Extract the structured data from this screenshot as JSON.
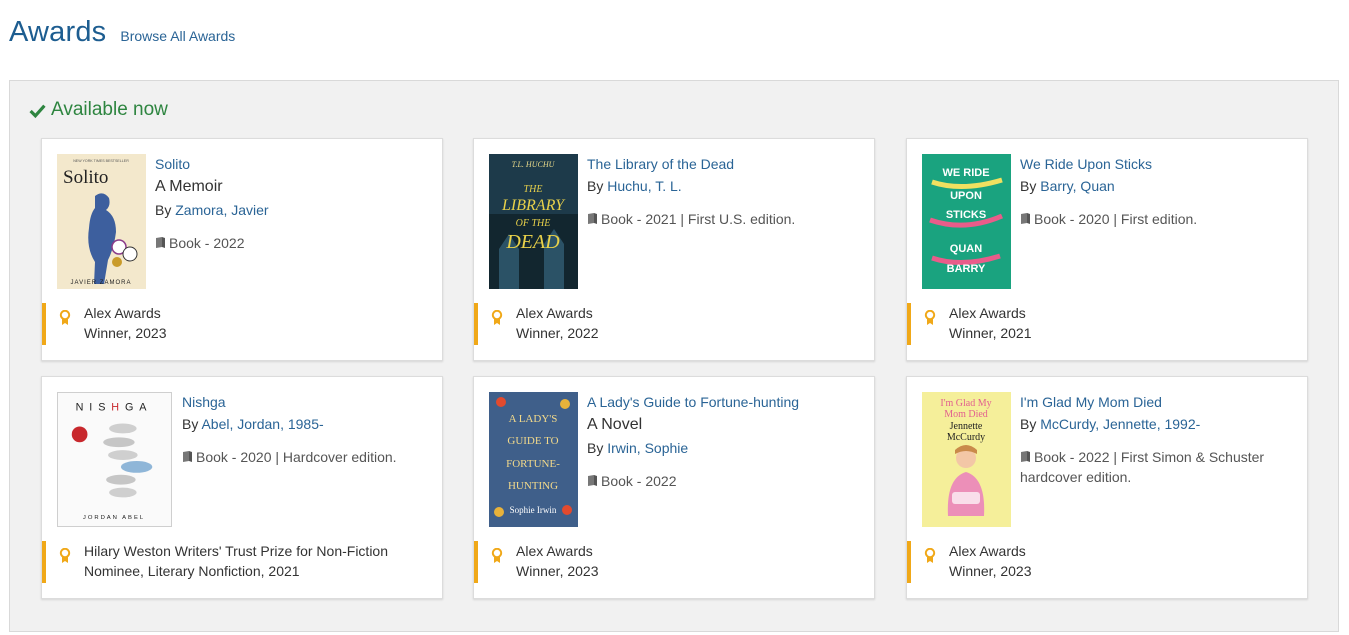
{
  "header": {
    "title": "Awards",
    "browse_link": "Browse All Awards"
  },
  "section": {
    "available_label": "Available now"
  },
  "colors": {
    "brand_blue": "#1d5d90",
    "link": "#2a6496",
    "available_green": "#2e8540",
    "award_accent": "#f0a818"
  },
  "cards": [
    {
      "title": "Solito",
      "subtitle": "A Memoir",
      "by_prefix": "By",
      "author": "Zamora, Javier",
      "format": "Book - 2022",
      "award_name": "Alex Awards",
      "award_detail": "Winner, 2023",
      "cover": {
        "top_text": "NEW YORK TIMES BESTSELLER",
        "title": "Solito",
        "author": "JAVIER ZAMORA"
      }
    },
    {
      "title": "The Library of the Dead",
      "by_prefix": "By",
      "author": "Huchu, T. L.",
      "format": "Book - 2021 | First U.S. edition.",
      "award_name": "Alex Awards",
      "award_detail": "Winner, 2022",
      "cover": {
        "author": "T.L. HUCHU",
        "line1": "THE",
        "line2": "LIBRARY",
        "line3": "OF THE",
        "line4": "DEAD"
      }
    },
    {
      "title": "We Ride Upon Sticks",
      "by_prefix": "By",
      "author": "Barry, Quan",
      "format": "Book - 2020 | First edition.",
      "award_name": "Alex Awards",
      "award_detail": "Winner, 2021",
      "cover": {
        "line1": "WE RIDE",
        "line2": "UPON",
        "line3": "STICKS",
        "line4": "QUAN",
        "line5": "BARRY"
      }
    },
    {
      "title": "Nishga",
      "by_prefix": "By",
      "author": "Abel, Jordan, 1985-",
      "format": "Book - 2020 | Hardcover edition.",
      "award_name": "Hilary Weston Writers' Trust Prize for Non-Fiction",
      "award_detail": "Nominee, Literary Nonfiction, 2021",
      "cover": {
        "title_a": "NIS",
        "title_b": "H",
        "title_c": "GA",
        "author": "JORDAN ABEL"
      }
    },
    {
      "title": "A Lady's Guide to Fortune-hunting",
      "subtitle": "A Novel",
      "by_prefix": "By",
      "author": "Irwin, Sophie",
      "format": "Book - 2022",
      "award_name": "Alex Awards",
      "award_detail": "Winner, 2023",
      "cover": {
        "line1": "A LADY'S",
        "line2": "GUIDE TO",
        "line3": "FORTUNE-",
        "line4": "HUNTING",
        "author": "Sophie Irwin"
      }
    },
    {
      "title": "I'm Glad My Mom Died",
      "by_prefix": "By",
      "author": "McCurdy, Jennette, 1992-",
      "format": "Book - 2022 | First Simon & Schuster",
      "format_cont": "hardcover edition.",
      "award_name": "Alex Awards",
      "award_detail": "Winner, 2023",
      "cover": {
        "line1": "I'm Glad My",
        "line2": "Mom Died",
        "author1": "Jennette",
        "author2": "McCurdy"
      }
    }
  ]
}
